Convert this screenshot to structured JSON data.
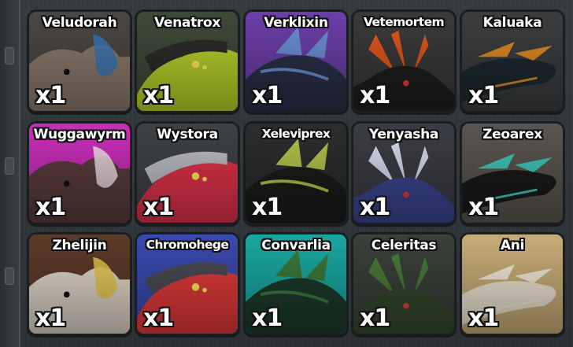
{
  "inventory": {
    "items": [
      {
        "name": "Veludorah",
        "qty": "x1",
        "bg": "#4a4744",
        "accent": "#3a78b8",
        "body": "#8c7a6c"
      },
      {
        "name": "Venatrox",
        "qty": "x1",
        "bg": "#3e4a38",
        "accent": "#b8d22a",
        "body": "#2c2c2a"
      },
      {
        "name": "Verklixin",
        "qty": "x1",
        "bg": "#6b3fa8",
        "accent": "#6b8fd6",
        "body": "#2a3048"
      },
      {
        "name": "Vetemortem",
        "qty": "x1",
        "bg": "#3a3a3a",
        "accent": "#e0581c",
        "body": "#1e1e1e"
      },
      {
        "name": "Kaluaka",
        "qty": "x1",
        "bg": "#3b3d3f",
        "accent": "#e08a22",
        "body": "#1c2a30"
      },
      {
        "name": "Wuggawyrm",
        "qty": "x1",
        "bg": "#c92fb8",
        "accent": "#f4e4ea",
        "body": "#5a3c3c"
      },
      {
        "name": "Wystora",
        "qty": "x1",
        "bg": "#3f4245",
        "accent": "#e0324a",
        "body": "#bcbcc4"
      },
      {
        "name": "Xeleviprex",
        "qty": "x1",
        "bg": "#2b2e2c",
        "accent": "#b4c24a",
        "body": "#1a1c1a"
      },
      {
        "name": "Yenyasha",
        "qty": "x1",
        "bg": "#3b3d44",
        "accent": "#d8dcef",
        "body": "#3a4690"
      },
      {
        "name": "Zeoarex",
        "qty": "x1",
        "bg": "#5a5550",
        "accent": "#3ec8b8",
        "body": "#1a1a1a"
      },
      {
        "name": "Zhelijin",
        "qty": "x1",
        "bg": "#5c3a28",
        "accent": "#e8c84a",
        "body": "#e0d6c8"
      },
      {
        "name": "Chromohege",
        "qty": "x1",
        "bg": "#3a4ab0",
        "accent": "#e23a3a",
        "body": "#4a4a54"
      },
      {
        "name": "Convarlia",
        "qty": "x1",
        "bg": "#1aa7a0",
        "accent": "#3a7a3a",
        "body": "#1c3a2a"
      },
      {
        "name": "Celeritas",
        "qty": "x1",
        "bg": "#3a403a",
        "accent": "#4a7a3a",
        "body": "#33492c"
      },
      {
        "name": "Ani",
        "qty": "x1",
        "bg": "#c9ad78",
        "accent": "#f2ead8",
        "body": "#ece4d2"
      }
    ]
  }
}
